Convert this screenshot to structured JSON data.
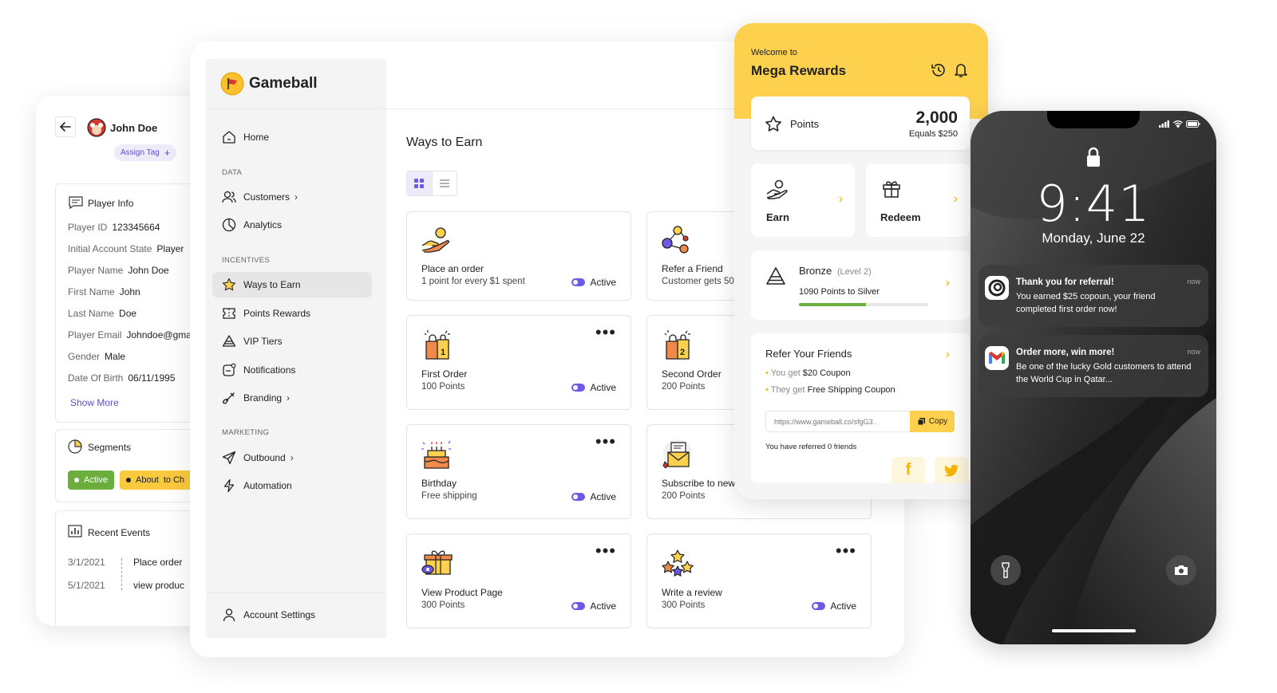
{
  "player": {
    "name": "John Doe",
    "assign_tag": "Assign Tag",
    "info_title": "Player Info",
    "fields": [
      {
        "label": "Player ID",
        "value": "123345664"
      },
      {
        "label": "Initial Account State",
        "value": "Player"
      },
      {
        "label": "Player Name",
        "value": "John Doe"
      },
      {
        "label": "First Name",
        "value": "John"
      },
      {
        "label": "Last Name",
        "value": "Doe"
      },
      {
        "label": "Player Email",
        "value": "Johndoe@gmai"
      },
      {
        "label": "Gender",
        "value": "Male"
      },
      {
        "label": "Date Of Birth",
        "value": "06/11/1995"
      }
    ],
    "show_more": "Show More",
    "segments_title": "Segments",
    "segments": [
      "Active",
      "About  to Ch"
    ],
    "events_title": "Recent Events",
    "events": [
      {
        "date": "3/1/2021",
        "event": "Place order"
      },
      {
        "date": "5/1/2021",
        "event": "view produc"
      }
    ]
  },
  "brand": {
    "name": "Gameball"
  },
  "sidebar": {
    "home": "Home",
    "sec_data": "DATA",
    "customers": "Customers",
    "analytics": "Analytics",
    "sec_incentives": "INCENTIVES",
    "ways": "Ways to Earn",
    "points": "Points Rewards",
    "vip": "VIP Tiers",
    "notifications": "Notifications",
    "branding": "Branding",
    "sec_marketing": "MARKETING",
    "outbound": "Outbound",
    "automation": "Automation",
    "account": "Account Settings"
  },
  "main": {
    "title": "Ways to Earn",
    "active_label": "Active",
    "cards": [
      {
        "title": "Place an order",
        "sub": "1 point for every $1 spent",
        "icon": "hand-coin-icon"
      },
      {
        "title": "Refer a Friend",
        "sub": "Customer gets 50",
        "icon": "referral-network-icon"
      },
      {
        "title": "First Order",
        "sub": "100 Points",
        "icon": "shopping-bag-1-icon"
      },
      {
        "title": "Second Order",
        "sub": "200 Points",
        "icon": "shopping-bag-2-icon"
      },
      {
        "title": "Birthday",
        "sub": "Free shipping",
        "icon": "birthday-cake-icon"
      },
      {
        "title": "Subscribe to new",
        "sub": "200 Points",
        "icon": "newsletter-envelope-icon"
      },
      {
        "title": "View Product Page",
        "sub": "300 Points",
        "icon": "product-box-icon"
      },
      {
        "title": "Write a review",
        "sub": "300 Points",
        "icon": "review-stars-icon"
      }
    ]
  },
  "widget": {
    "welcome": "Welcome to",
    "program": "Mega Rewards",
    "points_label": "Points",
    "points_value": "2,000",
    "points_equals": "Equals $250",
    "earn": "Earn",
    "redeem": "Redeem",
    "tier": "Bronze",
    "tier_level": "(Level 2)",
    "tier_progress_text": "1090 Points to Silver",
    "tier_progress": 0.52,
    "refer_title": "Refer Your Friends",
    "you_get": "You get",
    "you_get_value": "$20 Coupon",
    "they_get": "They get",
    "they_get_value": "Free Shipping Coupon",
    "link": "https://www.gameball.co/sfgG3..",
    "copy": "Copy",
    "referred": "You have referred 0 friends",
    "accent": "#fdd14e"
  },
  "phone": {
    "time": "9:41",
    "date": "Monday, June 22",
    "notifications": [
      {
        "title": "Thank you for referral!",
        "body": "You earned $25 copoun, your friend completed first order now!",
        "time": "now"
      },
      {
        "title": "Order more, win more!",
        "body": "Be one of the lucky Gold customers to attend the World Cup in Qatar...",
        "time": "now"
      }
    ]
  }
}
